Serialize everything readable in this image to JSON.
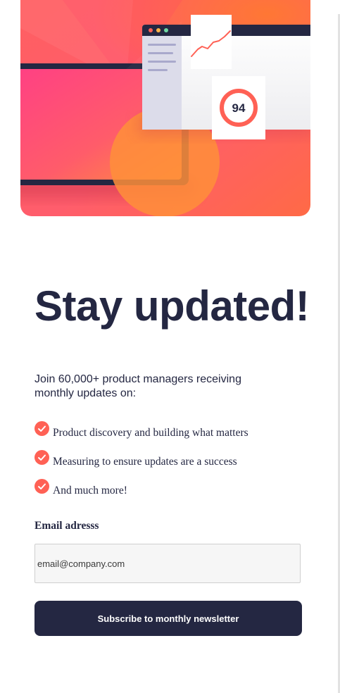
{
  "colors": {
    "navy": "#242742",
    "tomato": "#ff6155",
    "hero_gradient": [
      "#ff6a3a",
      "#ff527b"
    ],
    "input_bg": "#f6f6f6"
  },
  "illustration": {
    "score": "94"
  },
  "heading": "Stay updated!",
  "intro": "Join 60,000+ product managers receiving monthly updates on:",
  "features": [
    {
      "icon": "checkmark-icon",
      "text": "Product discovery and building what matters"
    },
    {
      "icon": "checkmark-icon",
      "text": "Measuring to ensure updates are a success"
    },
    {
      "icon": "checkmark-icon",
      "text": "And much more!"
    }
  ],
  "form": {
    "email_label": "Email adresss",
    "email_placeholder": "email@company.com",
    "email_value": "",
    "submit_label": "Subscribe to monthly newsletter"
  }
}
